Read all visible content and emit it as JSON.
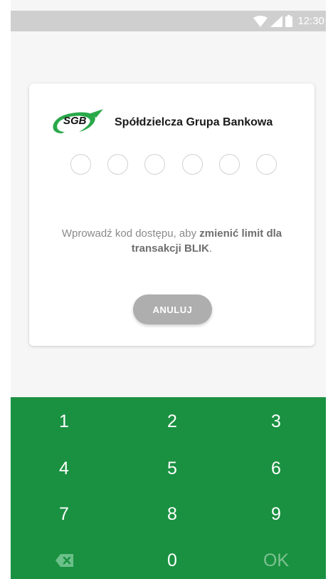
{
  "status_bar": {
    "time": "12:30"
  },
  "card": {
    "logo_text": "SGB",
    "bank_name": "Spółdzielcza Grupa Bankowa",
    "pin_length": 6,
    "instruction": {
      "part1": "Wprowadź kod dostępu, aby ",
      "bold1": "zmienić limit dla",
      "bold2": "transakcji BLIK",
      "part2": "."
    },
    "cancel_label": "ANULUJ"
  },
  "keypad": {
    "keys": [
      "1",
      "2",
      "3",
      "4",
      "5",
      "6",
      "7",
      "8",
      "9",
      "backspace-icon",
      "0",
      "OK"
    ],
    "ok_label": "OK",
    "colors": {
      "background": "#1a9141",
      "ok_disabled": "#7fc291"
    }
  },
  "colors": {
    "brand_green": "#1a9141",
    "logo_green": "#2aa84a"
  }
}
